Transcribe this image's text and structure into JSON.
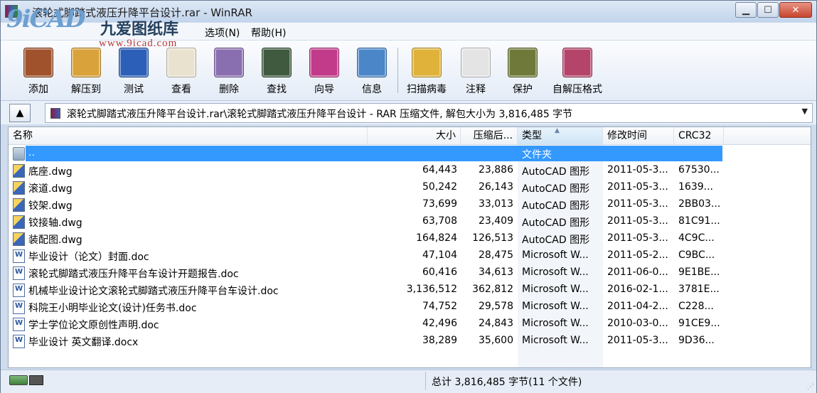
{
  "window": {
    "title": "滚轮式脚踏式液压升降平台设计.rar - WinRAR"
  },
  "watermark": {
    "main": "9iCAD",
    "cn": "九爱图纸库",
    "url": "www.9icad.com"
  },
  "menu": {
    "items": [
      {
        "label": "选项(N)"
      },
      {
        "label": "帮助(H)"
      }
    ]
  },
  "toolbar": {
    "items": [
      {
        "label": "添加",
        "icon": "archive-books-icon",
        "color": "#a0522d"
      },
      {
        "label": "解压到",
        "icon": "extract-folder-icon",
        "color": "#d9a23b"
      },
      {
        "label": "测试",
        "icon": "test-checkbox-icon",
        "color": "#2b5fb8"
      },
      {
        "label": "查看",
        "icon": "view-glasses-icon",
        "color": "#e8e2cf"
      },
      {
        "label": "删除",
        "icon": "delete-recycle-icon",
        "color": "#8a6fb0"
      },
      {
        "label": "查找",
        "icon": "find-binoculars-icon",
        "color": "#3f5a3f"
      },
      {
        "label": "向导",
        "icon": "wizard-icon",
        "color": "#c23b8a"
      },
      {
        "label": "信息",
        "icon": "info-icon",
        "color": "#4a86c8"
      },
      {
        "label": "扫描病毒",
        "icon": "virus-scan-icon",
        "color": "#e0b23a"
      },
      {
        "label": "注释",
        "icon": "comment-pencil-icon",
        "color": "#e4e4e4"
      },
      {
        "label": "保护",
        "icon": "protect-shield-icon",
        "color": "#6f7a3a"
      },
      {
        "label": "自解压格式",
        "icon": "sfx-archive-icon",
        "color": "#b5446a"
      }
    ]
  },
  "address": {
    "text": "滚轮式脚踏式液压升降平台设计.rar\\滚轮式脚踏式液压升降平台设计 - RAR 压缩文件, 解包大小为 3,816,485 字节"
  },
  "columns": {
    "name": "名称",
    "size": "大小",
    "packed": "压缩后...",
    "type": "类型",
    "modified": "修改时间",
    "crc": "CRC32"
  },
  "rows": [
    {
      "name": "..",
      "size": "",
      "packed": "",
      "type": "文件夹",
      "modified": "",
      "crc": "",
      "icon": "folder"
    },
    {
      "name": "底座.dwg",
      "size": "64,443",
      "packed": "23,886",
      "type": "AutoCAD 图形",
      "modified": "2011-05-3...",
      "crc": "67530...",
      "icon": "dwg"
    },
    {
      "name": "滚道.dwg",
      "size": "50,242",
      "packed": "26,143",
      "type": "AutoCAD 图形",
      "modified": "2011-05-3...",
      "crc": "1639...",
      "icon": "dwg"
    },
    {
      "name": "铰架.dwg",
      "size": "73,699",
      "packed": "33,013",
      "type": "AutoCAD 图形",
      "modified": "2011-05-3...",
      "crc": "2BB03...",
      "icon": "dwg"
    },
    {
      "name": "铰接轴.dwg",
      "size": "63,708",
      "packed": "23,409",
      "type": "AutoCAD 图形",
      "modified": "2011-05-3...",
      "crc": "81C91...",
      "icon": "dwg"
    },
    {
      "name": "装配图.dwg",
      "size": "164,824",
      "packed": "126,513",
      "type": "AutoCAD 图形",
      "modified": "2011-05-3...",
      "crc": "4C9C...",
      "icon": "dwg"
    },
    {
      "name": "毕业设计（论文）封面.doc",
      "size": "47,104",
      "packed": "28,475",
      "type": "Microsoft W...",
      "modified": "2011-05-2...",
      "crc": "C9BC...",
      "icon": "doc"
    },
    {
      "name": "滚轮式脚踏式液压升降平台车设计开题报告.doc",
      "size": "60,416",
      "packed": "34,613",
      "type": "Microsoft W...",
      "modified": "2011-06-0...",
      "crc": "9E1BE...",
      "icon": "doc"
    },
    {
      "name": "机械毕业设计论文滚轮式脚踏式液压升降平台车设计.doc",
      "size": "3,136,512",
      "packed": "362,812",
      "type": "Microsoft W...",
      "modified": "2016-02-1...",
      "crc": "3781E...",
      "icon": "doc"
    },
    {
      "name": "科院王小明毕业论文(设计)任务书.doc",
      "size": "74,752",
      "packed": "29,578",
      "type": "Microsoft W...",
      "modified": "2011-04-2...",
      "crc": "C228...",
      "icon": "doc"
    },
    {
      "name": "学士学位论文原创性声明.doc",
      "size": "42,496",
      "packed": "24,843",
      "type": "Microsoft W...",
      "modified": "2010-03-0...",
      "crc": "91CE9...",
      "icon": "doc"
    },
    {
      "name": "毕业设计  英文翻译.docx",
      "size": "38,289",
      "packed": "35,600",
      "type": "Microsoft W...",
      "modified": "2011-05-3...",
      "crc": "9D36...",
      "icon": "doc"
    }
  ],
  "status": {
    "text": "总计 3,816,485 字节(11 个文件)"
  }
}
